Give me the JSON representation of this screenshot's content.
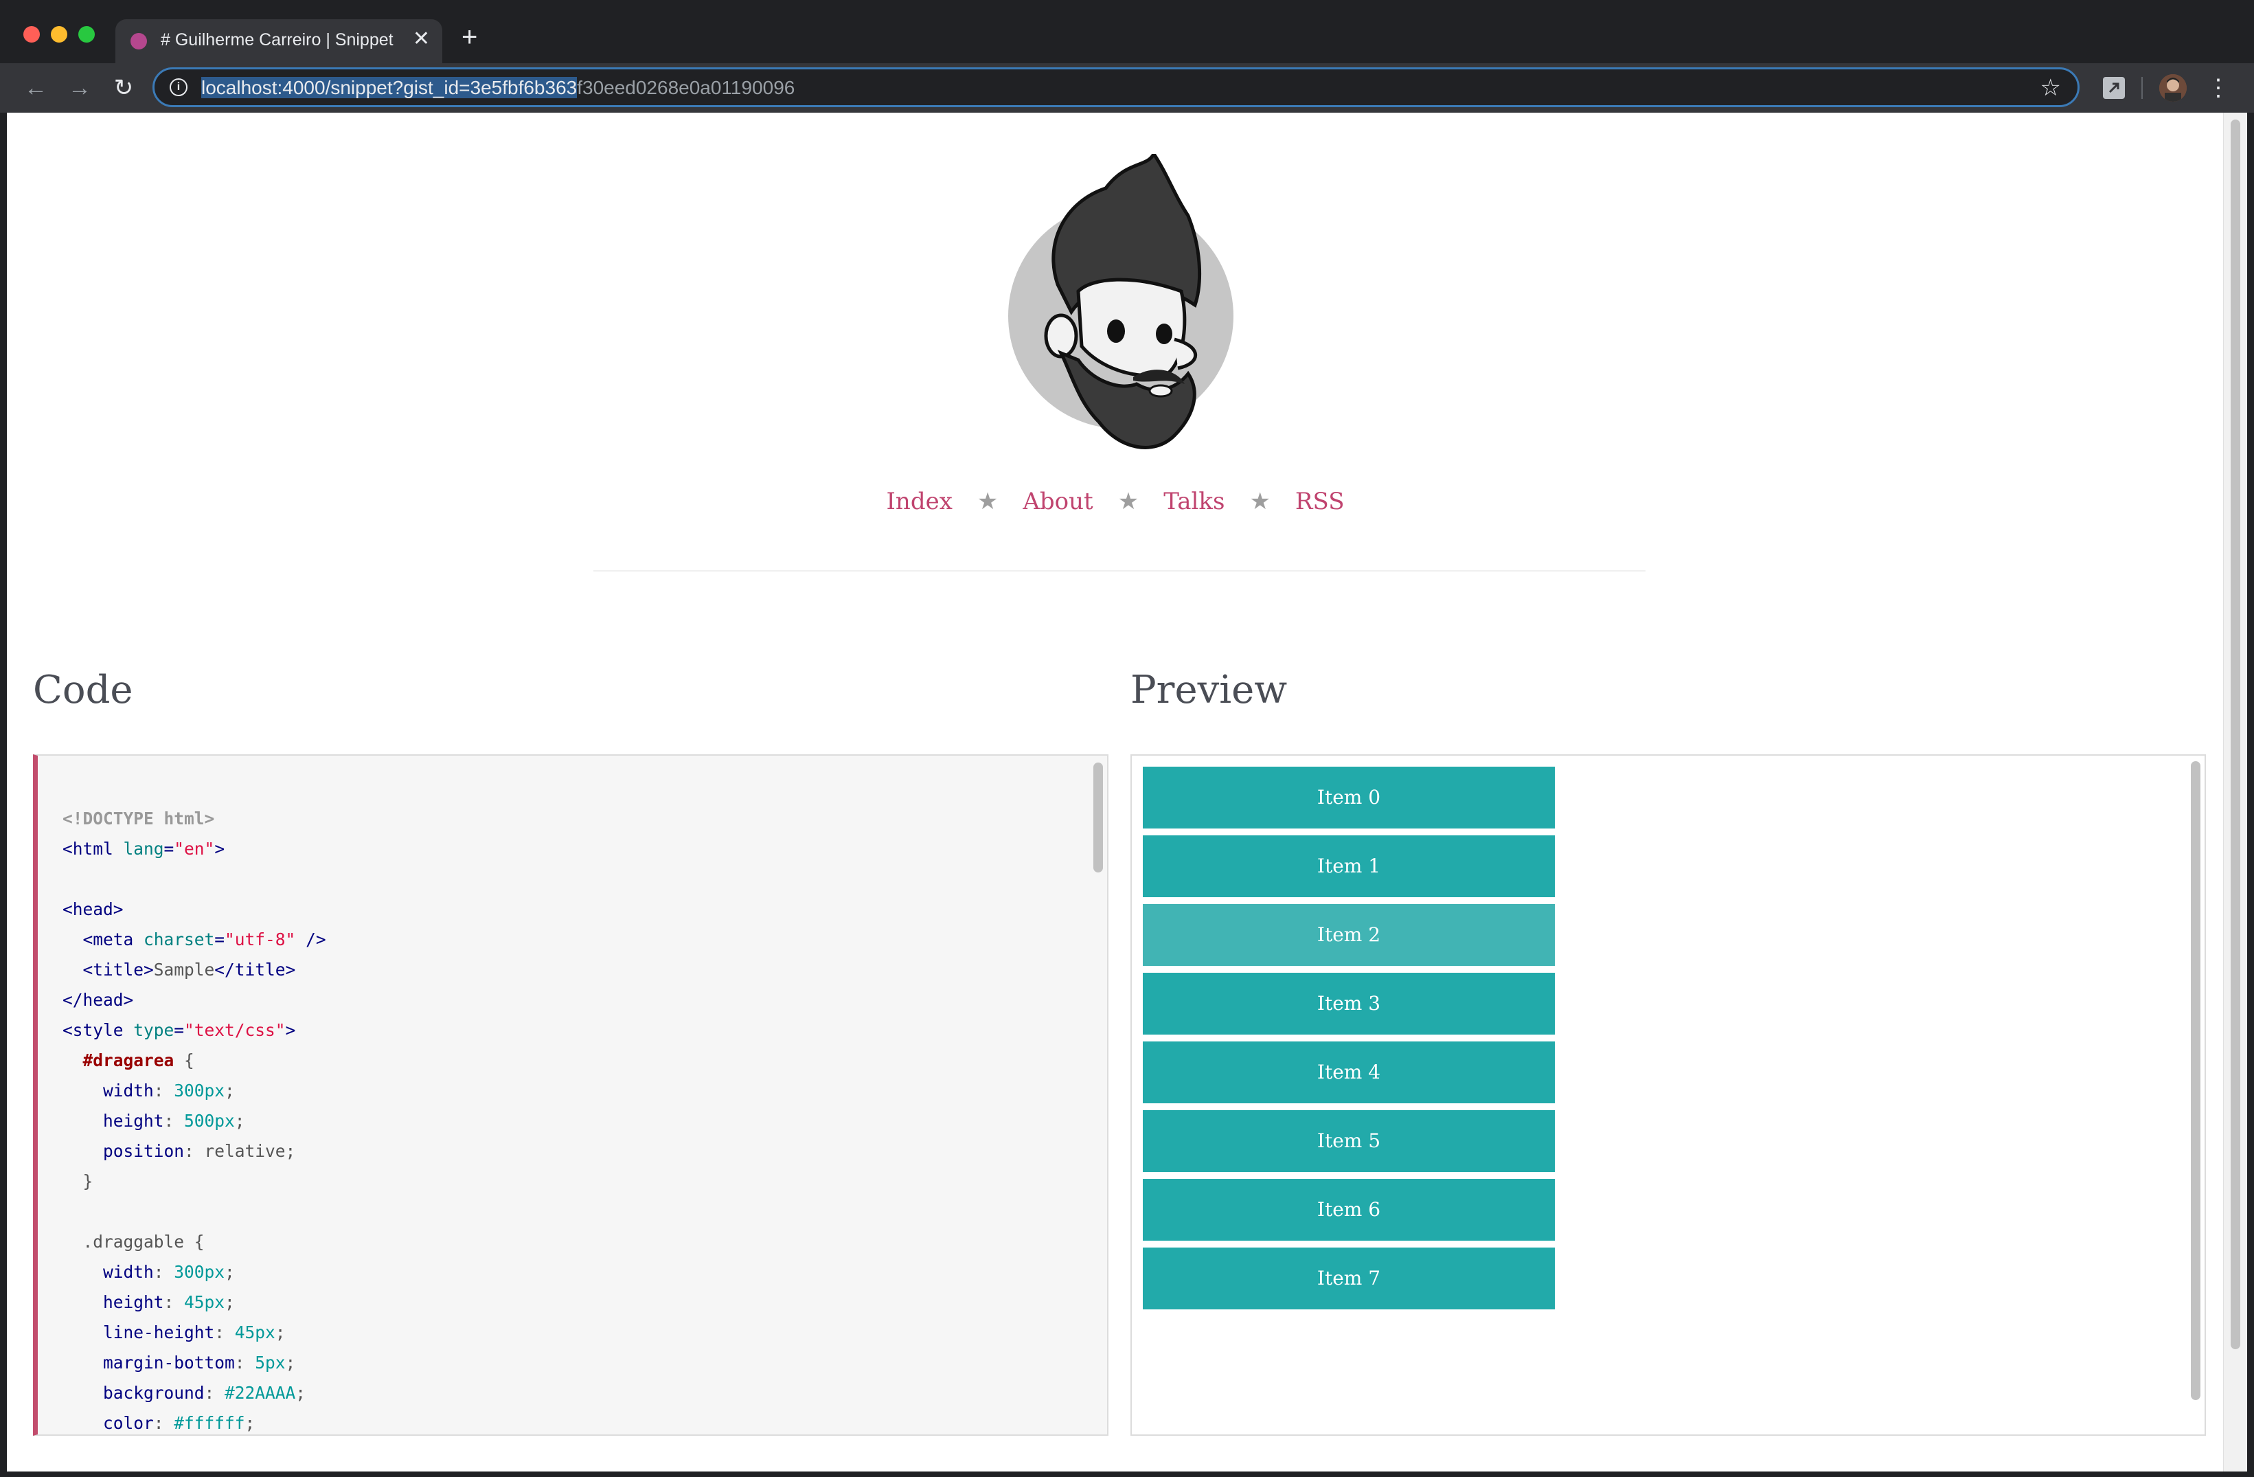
{
  "browser": {
    "tab_title": "# Guilherme Carreiro | Snippet",
    "tab_close": "✕",
    "new_tab": "+",
    "url_selected": "localhost:4000/snippet?gist_id=3e5fbf6b363",
    "url_rest": "f30eed0268e0a01190096",
    "back": "←",
    "forward": "→",
    "reload": "↻",
    "info": "i",
    "star": "☆",
    "menu": "⋮"
  },
  "site_nav": {
    "items": [
      "Index",
      "About",
      "Talks",
      "RSS"
    ],
    "separator": "★"
  },
  "sections": {
    "code_title": "Code",
    "preview_title": "Preview"
  },
  "code_lines": [
    [
      [
        "c-doctype",
        "<!DOCTYPE html>"
      ]
    ],
    [
      [
        "c-tag",
        "<html "
      ],
      [
        "c-attr",
        "lang"
      ],
      [
        "c-tag",
        "="
      ],
      [
        "c-str",
        "\"en\""
      ],
      [
        "c-tag",
        ">"
      ]
    ],
    [],
    [
      [
        "c-tag",
        "<head>"
      ]
    ],
    [
      [
        "c-tag",
        "  <meta "
      ],
      [
        "c-attr",
        "charset"
      ],
      [
        "c-tag",
        "="
      ],
      [
        "c-str",
        "\"utf-8\""
      ],
      [
        "c-tag",
        " />"
      ]
    ],
    [
      [
        "c-tag",
        "  <title>"
      ],
      [
        "c-plain",
        "Sample"
      ],
      [
        "c-tag",
        "</title>"
      ]
    ],
    [
      [
        "c-tag",
        "</head>"
      ]
    ],
    [
      [
        "c-tag",
        "<style "
      ],
      [
        "c-attr",
        "type"
      ],
      [
        "c-tag",
        "="
      ],
      [
        "c-str",
        "\"text/css\""
      ],
      [
        "c-tag",
        ">"
      ]
    ],
    [
      [
        "c-plain",
        "  "
      ],
      [
        "c-sel",
        "#dragarea"
      ],
      [
        "c-plain",
        " {"
      ]
    ],
    [
      [
        "c-prop",
        "    width"
      ],
      [
        "c-plain",
        ": "
      ],
      [
        "c-num",
        "300px"
      ],
      [
        "c-plain",
        ";"
      ]
    ],
    [
      [
        "c-prop",
        "    height"
      ],
      [
        "c-plain",
        ": "
      ],
      [
        "c-num",
        "500px"
      ],
      [
        "c-plain",
        ";"
      ]
    ],
    [
      [
        "c-prop",
        "    position"
      ],
      [
        "c-plain",
        ": relative;"
      ]
    ],
    [
      [
        "c-plain",
        "  }"
      ]
    ],
    [],
    [
      [
        "c-plain",
        "  .draggable {"
      ]
    ],
    [
      [
        "c-prop",
        "    width"
      ],
      [
        "c-plain",
        ": "
      ],
      [
        "c-num",
        "300px"
      ],
      [
        "c-plain",
        ";"
      ]
    ],
    [
      [
        "c-prop",
        "    height"
      ],
      [
        "c-plain",
        ": "
      ],
      [
        "c-num",
        "45px"
      ],
      [
        "c-plain",
        ";"
      ]
    ],
    [
      [
        "c-prop",
        "    line-height"
      ],
      [
        "c-plain",
        ": "
      ],
      [
        "c-num",
        "45px"
      ],
      [
        "c-plain",
        ";"
      ]
    ],
    [
      [
        "c-prop",
        "    margin-bottom"
      ],
      [
        "c-plain",
        ": "
      ],
      [
        "c-num",
        "5px"
      ],
      [
        "c-plain",
        ";"
      ]
    ],
    [
      [
        "c-prop",
        "    background"
      ],
      [
        "c-plain",
        ": "
      ],
      [
        "c-num",
        "#22AAAA"
      ],
      [
        "c-plain",
        ";"
      ]
    ],
    [
      [
        "c-prop",
        "    color"
      ],
      [
        "c-plain",
        ": "
      ],
      [
        "c-num",
        "#ffffff"
      ],
      [
        "c-plain",
        ";"
      ]
    ]
  ],
  "preview_items": [
    "Item 0",
    "Item 1",
    "Item 2",
    "Item 3",
    "Item 4",
    "Item 5",
    "Item 6",
    "Item 7"
  ],
  "dragging_item": "Item 2",
  "colors": {
    "accent": "#c0446f",
    "item_bg": "#22AAAA",
    "item_dragging_bg": "#41b4b4"
  }
}
